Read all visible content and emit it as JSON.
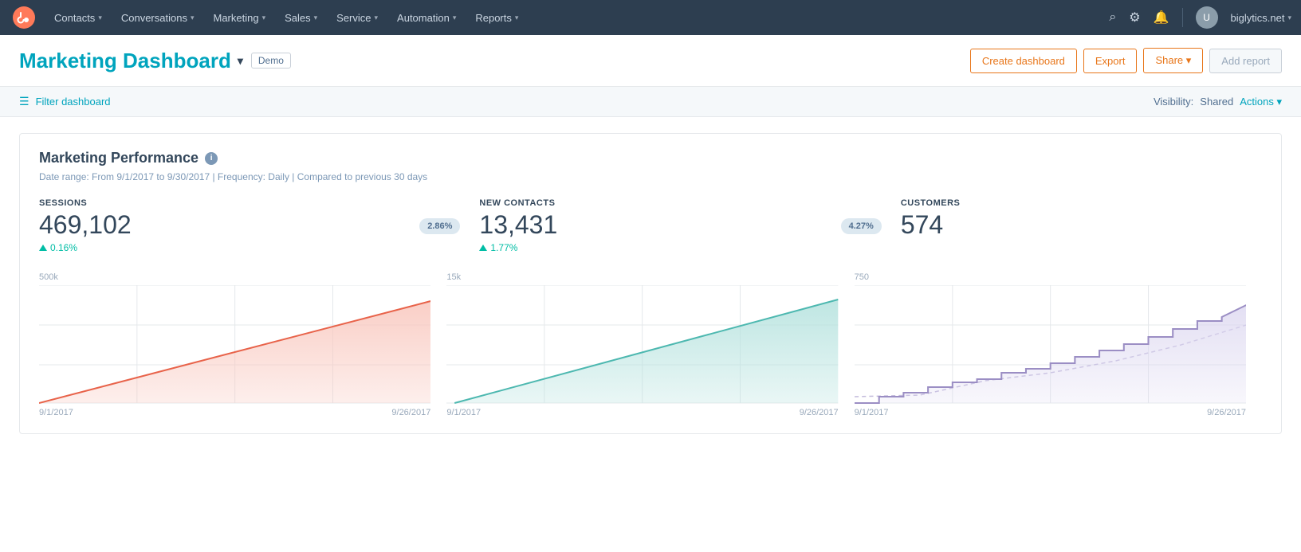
{
  "nav": {
    "items": [
      {
        "label": "Contacts",
        "id": "contacts"
      },
      {
        "label": "Conversations",
        "id": "conversations"
      },
      {
        "label": "Marketing",
        "id": "marketing"
      },
      {
        "label": "Sales",
        "id": "sales"
      },
      {
        "label": "Service",
        "id": "service"
      },
      {
        "label": "Automation",
        "id": "automation"
      },
      {
        "label": "Reports",
        "id": "reports"
      }
    ],
    "account": "biglytics.net"
  },
  "header": {
    "title": "Marketing Dashboard",
    "badge": "Demo",
    "buttons": {
      "create": "Create dashboard",
      "export": "Export",
      "share": "Share ▾",
      "add_report": "Add report"
    }
  },
  "filter_bar": {
    "filter_label": "Filter dashboard",
    "visibility_label": "Visibility:",
    "visibility_value": "Shared",
    "actions_label": "Actions ▾"
  },
  "widget": {
    "title": "Marketing Performance",
    "info_icon": "i",
    "meta": "Date range: From 9/1/2017 to 9/30/2017  |  Frequency: Daily  |  Compared to previous 30 days",
    "metrics": [
      {
        "id": "sessions",
        "label": "SESSIONS",
        "value": "469,102",
        "change": "0.16%",
        "change_positive": true,
        "badge": "2.86%"
      },
      {
        "id": "new-contacts",
        "label": "NEW CONTACTS",
        "value": "13,431",
        "change": "1.77%",
        "change_positive": true,
        "badge": "4.27%"
      },
      {
        "id": "customers",
        "label": "CUSTOMERS",
        "value": "574",
        "change": null,
        "change_positive": false,
        "badge": null
      }
    ],
    "charts": [
      {
        "id": "sessions-chart",
        "y_label": "500k",
        "x_start": "9/1/2017",
        "x_end": "9/26/2017",
        "color_fill": "#f9c9c0",
        "color_stroke": "#e8634a",
        "type": "area_up"
      },
      {
        "id": "contacts-chart",
        "y_label": "15k",
        "x_start": "9/1/2017",
        "x_end": "9/26/2017",
        "color_fill": "#b7e3df",
        "color_stroke": "#4db8b0",
        "type": "area_up"
      },
      {
        "id": "customers-chart",
        "y_label": "750",
        "x_start": "9/1/2017",
        "x_end": "9/26/2017",
        "color_fill": "#dcd7f0",
        "color_stroke": "#9b8ec4",
        "type": "area_stepup"
      }
    ]
  }
}
